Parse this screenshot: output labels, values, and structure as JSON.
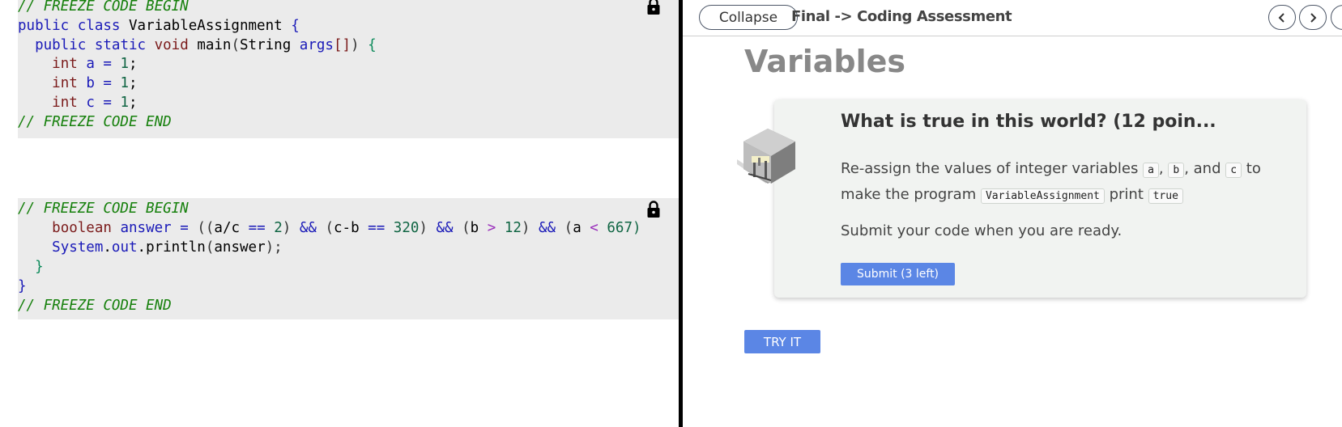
{
  "editor": {
    "top_block": {
      "line1": "// FREEZE CODE BEGIN",
      "line2_kw1": "public",
      "line2_kw2": "class",
      "line2_name": "VariableAssignment",
      "line2_brace": "{",
      "line3_kw1": "public",
      "line3_kw2": "static",
      "line3_kw3": "void",
      "line3_name": "main",
      "line3_paren": "(",
      "line3_type": "String",
      "line3_arg": "args",
      "line3_bracket": "[]",
      "line3_close": ")",
      "line3_brace": "{",
      "var_a_type": "int",
      "var_a_name": "a",
      "var_a_eq": "=",
      "var_a_val": "1",
      "var_a_semi": ";",
      "var_b_type": "int",
      "var_b_name": "b",
      "var_b_eq": "=",
      "var_b_val": "1",
      "var_b_semi": ";",
      "var_c_type": "int",
      "var_c_name": "c",
      "var_c_eq": "=",
      "var_c_val": "1",
      "var_c_semi": ";",
      "line_end": "// FREEZE CODE END"
    },
    "bottom_block": {
      "line1": "// FREEZE CODE BEGIN",
      "bool_type": "boolean",
      "bool_name": "answer",
      "bool_eq": "=",
      "expr_open": "((",
      "expr_a1": "a/c",
      "expr_eq1": "==",
      "expr_v1": "2",
      "expr_close1": ")",
      "expr_and1": "&&",
      "expr_open2": "(",
      "expr_a2": "c-b",
      "expr_eq2": "==",
      "expr_v2": "320",
      "expr_close2": ")",
      "expr_and2": "&&",
      "expr_open3": "(",
      "expr_a3": "b",
      "expr_gt": ">",
      "expr_v3": "12",
      "expr_close3": ")",
      "expr_and3": "&&",
      "expr_open4": "(",
      "expr_a4": "a",
      "expr_lt": "<",
      "expr_v4": "667)",
      "print_obj": "System",
      "print_dot1": ".",
      "print_field": "out",
      "print_dot2": ".",
      "print_method": "println",
      "print_open": "(",
      "print_arg": "answer",
      "print_close": ");",
      "brace1": "}",
      "brace2": "}",
      "line_end": "// FREEZE CODE END"
    }
  },
  "topbar": {
    "collapse_label": "Collapse",
    "breadcrumb": "Final -> Coding Assessment"
  },
  "lesson": {
    "title": "Variables",
    "task_title": "What is true in this world? (12 poin...",
    "task_text_1": "Re-assign the values of integer variables ",
    "code_a": "a",
    "sep1": ", ",
    "code_b": "b",
    "sep2": ", and ",
    "code_c": "c",
    "task_text_2": " to make the program ",
    "code_program": "VariableAssignment",
    "task_text_3": " print ",
    "code_true": "true",
    "submit_text": "Submit your code when you are ready.",
    "submit_label": "Submit (3 left)",
    "try_label": "TRY IT"
  },
  "colors": {
    "frozen_bg": "#ebebeb",
    "comment": "#16800c",
    "button": "#5b86e5",
    "divider": "#000000"
  },
  "icons": [
    "lock-icon",
    "chevron-left-icon",
    "chevron-right-icon",
    "building-illustration-icon"
  ]
}
